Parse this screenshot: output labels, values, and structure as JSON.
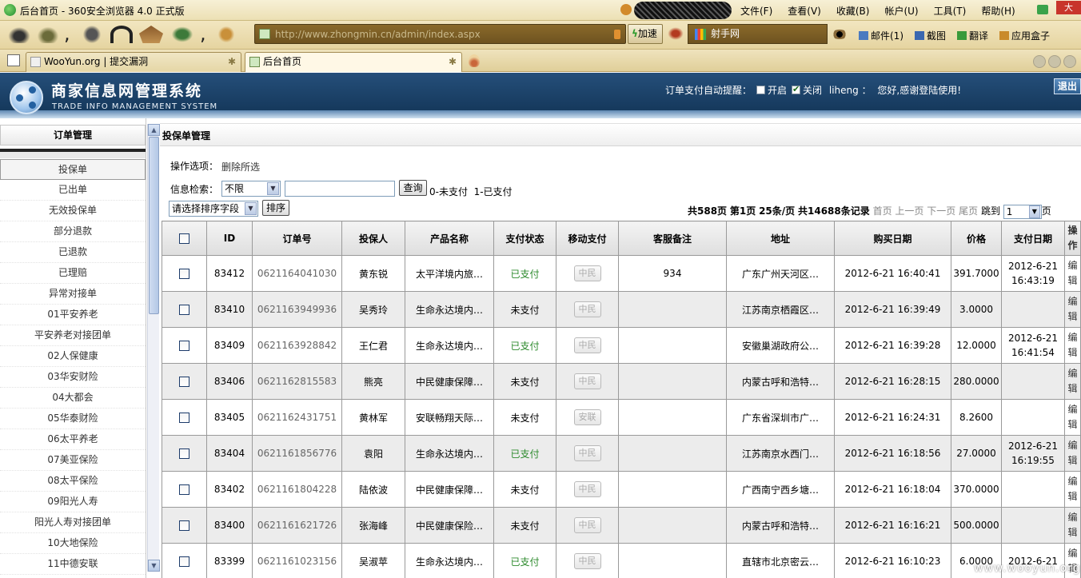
{
  "browser": {
    "window_title": "后台首页 - 360安全浏览器 4.0 正式版",
    "menus": [
      "文件(F)",
      "查看(V)",
      "收藏(B)",
      "帐户(U)",
      "工具(T)",
      "帮助(H)"
    ],
    "close_label": "大",
    "url": "http://www.zhongmin.cn/admin/index.aspx",
    "speedup_label": "加速",
    "search_engine_label": "射手网",
    "tools": [
      "邮件(1)",
      "截图",
      "翻译",
      "应用盒子"
    ],
    "tabs": [
      {
        "label": "WooYun.org | 提交漏洞"
      },
      {
        "label": "后台首页"
      }
    ]
  },
  "app": {
    "title": "商家信息网管理系统",
    "subtitle": "TRADE INFO MANAGEMENT SYSTEM",
    "reminder_label": "订单支付自动提醒：",
    "on_label": "开启",
    "off_label": "关闭",
    "user": "liheng",
    "greeting": "您好,感谢登陆使用!",
    "logout_label": "退出"
  },
  "sidebar": {
    "header": "订单管理",
    "items": [
      "投保单",
      "已出单",
      "无效投保单",
      "部分退款",
      "已退款",
      "已理赔",
      "异常对接单",
      "01平安养老",
      "平安养老对接团单",
      "02人保健康",
      "03华安财险",
      "04大都会",
      "05华泰财险",
      "06太平养老",
      "07美亚保险",
      "08太平保险",
      "09阳光人寿",
      "阳光人寿对接团单",
      "10大地保险",
      "11中德安联"
    ]
  },
  "main": {
    "heading": "投保单管理",
    "ops_label": "操作选项：",
    "delete_selected": "删除所选",
    "search_label": "信息检索：",
    "search_select": "不限",
    "query_button": "查询",
    "pay_hint": "0-未支付  1-已支付",
    "sort_select": "请选择排序字段",
    "sort_button": "排序",
    "pager": {
      "total_pages": "共588页",
      "current_page": "第1页",
      "per_page": "25条/页",
      "total_records": "共14688条记录",
      "first": "首页",
      "prev": "上一页",
      "next": "下一页",
      "last": "尾页",
      "jump": "跳到",
      "page_value": "1",
      "page_suffix": "页"
    },
    "columns": [
      "ID",
      "订单号",
      "投保人",
      "产品名称",
      "支付状态",
      "移动支付",
      "客服备注",
      "地址",
      "购买日期",
      "价格",
      "支付日期",
      "操作"
    ],
    "rows": [
      {
        "id": "83412",
        "order": "0621164041030",
        "holder": "黄东锐",
        "product": "太平洋境内旅…",
        "status": "已支付",
        "mobile": "中民",
        "note": "934",
        "addr": "广东广州天河区…",
        "date": "2012-6-21 16:40:41",
        "price": "391.7000",
        "paydate": "2012-6-21 16:43:19",
        "op": "编辑"
      },
      {
        "id": "83410",
        "order": "0621163949936",
        "holder": "吴秀玲",
        "product": "生命永达境内…",
        "status": "未支付",
        "mobile": "中民",
        "note": "",
        "addr": "江苏南京栖霞区…",
        "date": "2012-6-21 16:39:49",
        "price": "3.0000",
        "paydate": "",
        "op": "编辑"
      },
      {
        "id": "83409",
        "order": "0621163928842",
        "holder": "王仁君",
        "product": "生命永达境内…",
        "status": "已支付",
        "mobile": "中民",
        "note": "",
        "addr": "安徽巢湖政府公…",
        "date": "2012-6-21 16:39:28",
        "price": "12.0000",
        "paydate": "2012-6-21 16:41:54",
        "op": "编辑"
      },
      {
        "id": "83406",
        "order": "0621162815583",
        "holder": "熊亮",
        "product": "中民健康保障…",
        "status": "未支付",
        "mobile": "中民",
        "note": "",
        "addr": "内蒙古呼和浩特…",
        "date": "2012-6-21 16:28:15",
        "price": "280.0000",
        "paydate": "",
        "op": "编辑"
      },
      {
        "id": "83405",
        "order": "0621162431751",
        "holder": "黄林军",
        "product": "安联畅翔天际…",
        "status": "未支付",
        "mobile": "安联",
        "note": "",
        "addr": "广东省深圳市广…",
        "date": "2012-6-21 16:24:31",
        "price": "8.2600",
        "paydate": "",
        "op": "编辑"
      },
      {
        "id": "83404",
        "order": "0621161856776",
        "holder": "袁阳",
        "product": "生命永达境内…",
        "status": "已支付",
        "mobile": "中民",
        "note": "",
        "addr": "江苏南京水西门…",
        "date": "2012-6-21 16:18:56",
        "price": "27.0000",
        "paydate": "2012-6-21 16:19:55",
        "op": "编辑"
      },
      {
        "id": "83402",
        "order": "0621161804228",
        "holder": "陆依波",
        "product": "中民健康保障…",
        "status": "未支付",
        "mobile": "中民",
        "note": "",
        "addr": "广西南宁西乡塘…",
        "date": "2012-6-21 16:18:04",
        "price": "370.0000",
        "paydate": "",
        "op": "编辑"
      },
      {
        "id": "83400",
        "order": "0621161621726",
        "holder": "张海峰",
        "product": "中民健康保险…",
        "status": "未支付",
        "mobile": "中民",
        "note": "",
        "addr": "内蒙古呼和浩特…",
        "date": "2012-6-21 16:16:21",
        "price": "500.0000",
        "paydate": "",
        "op": "编辑"
      },
      {
        "id": "83399",
        "order": "0621161023156",
        "holder": "吴淑苹",
        "product": "生命永达境内…",
        "status": "已支付",
        "mobile": "中民",
        "note": "",
        "addr": "直辖市北京密云…",
        "date": "2012-6-21 16:10:23",
        "price": "6.0000",
        "paydate": "2012-6-21",
        "op": "编辑"
      }
    ]
  },
  "watermark": "www.wooyun.org",
  "colors": {
    "header_blue": "#123456",
    "paid_green": "#2c8a2c",
    "chrome_tan": "#ece0b4"
  }
}
